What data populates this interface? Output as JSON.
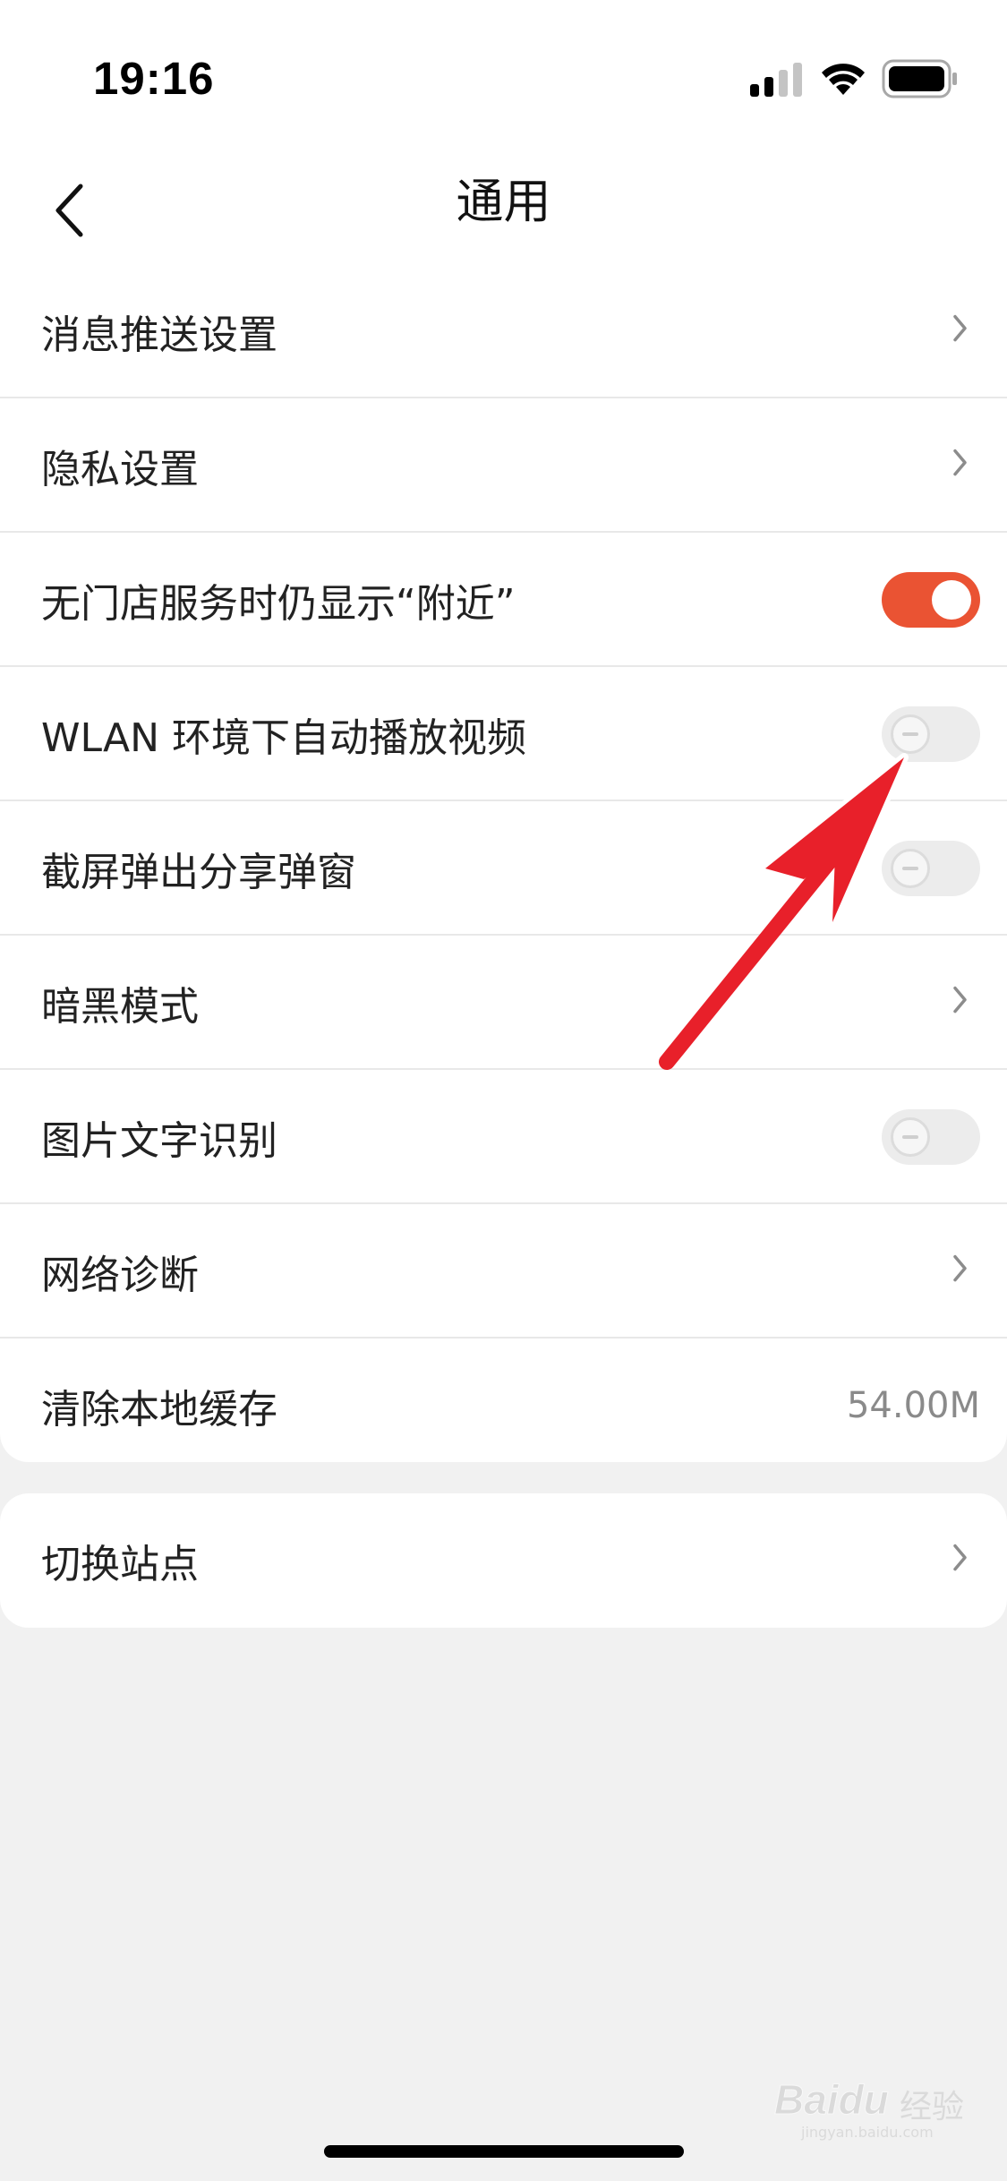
{
  "status_bar": {
    "time": "19:16",
    "icons": [
      "signal-icon",
      "wifi-icon",
      "battery-icon"
    ]
  },
  "nav": {
    "title": "通用",
    "back_icon": "chevron-left-icon"
  },
  "settings": {
    "items": [
      {
        "label": "消息推送设置",
        "control": "chevron"
      },
      {
        "label": "隐私设置",
        "control": "chevron"
      },
      {
        "label": "无门店服务时仍显示“附近”",
        "control": "toggle",
        "enabled": true
      },
      {
        "label": "WLAN 环境下自动播放视频",
        "control": "toggle",
        "enabled": false
      },
      {
        "label": "截屏弹出分享弹窗",
        "control": "toggle",
        "enabled": false
      },
      {
        "label": "暗黑模式",
        "control": "chevron"
      },
      {
        "label": "图片文字识别",
        "control": "toggle",
        "enabled": false
      },
      {
        "label": "网络诊断",
        "control": "chevron"
      },
      {
        "label": "清除本地缓存",
        "control": "value",
        "value": "54.00M"
      }
    ],
    "station": {
      "label": "切换站点",
      "control": "chevron"
    }
  },
  "colors": {
    "accent": "#ea5333",
    "background": "#f1f1f1",
    "arrow": "#e8202a"
  },
  "watermark": {
    "brand": "Baidu",
    "suffix": "经验",
    "url": "jingyan.baidu.com"
  }
}
